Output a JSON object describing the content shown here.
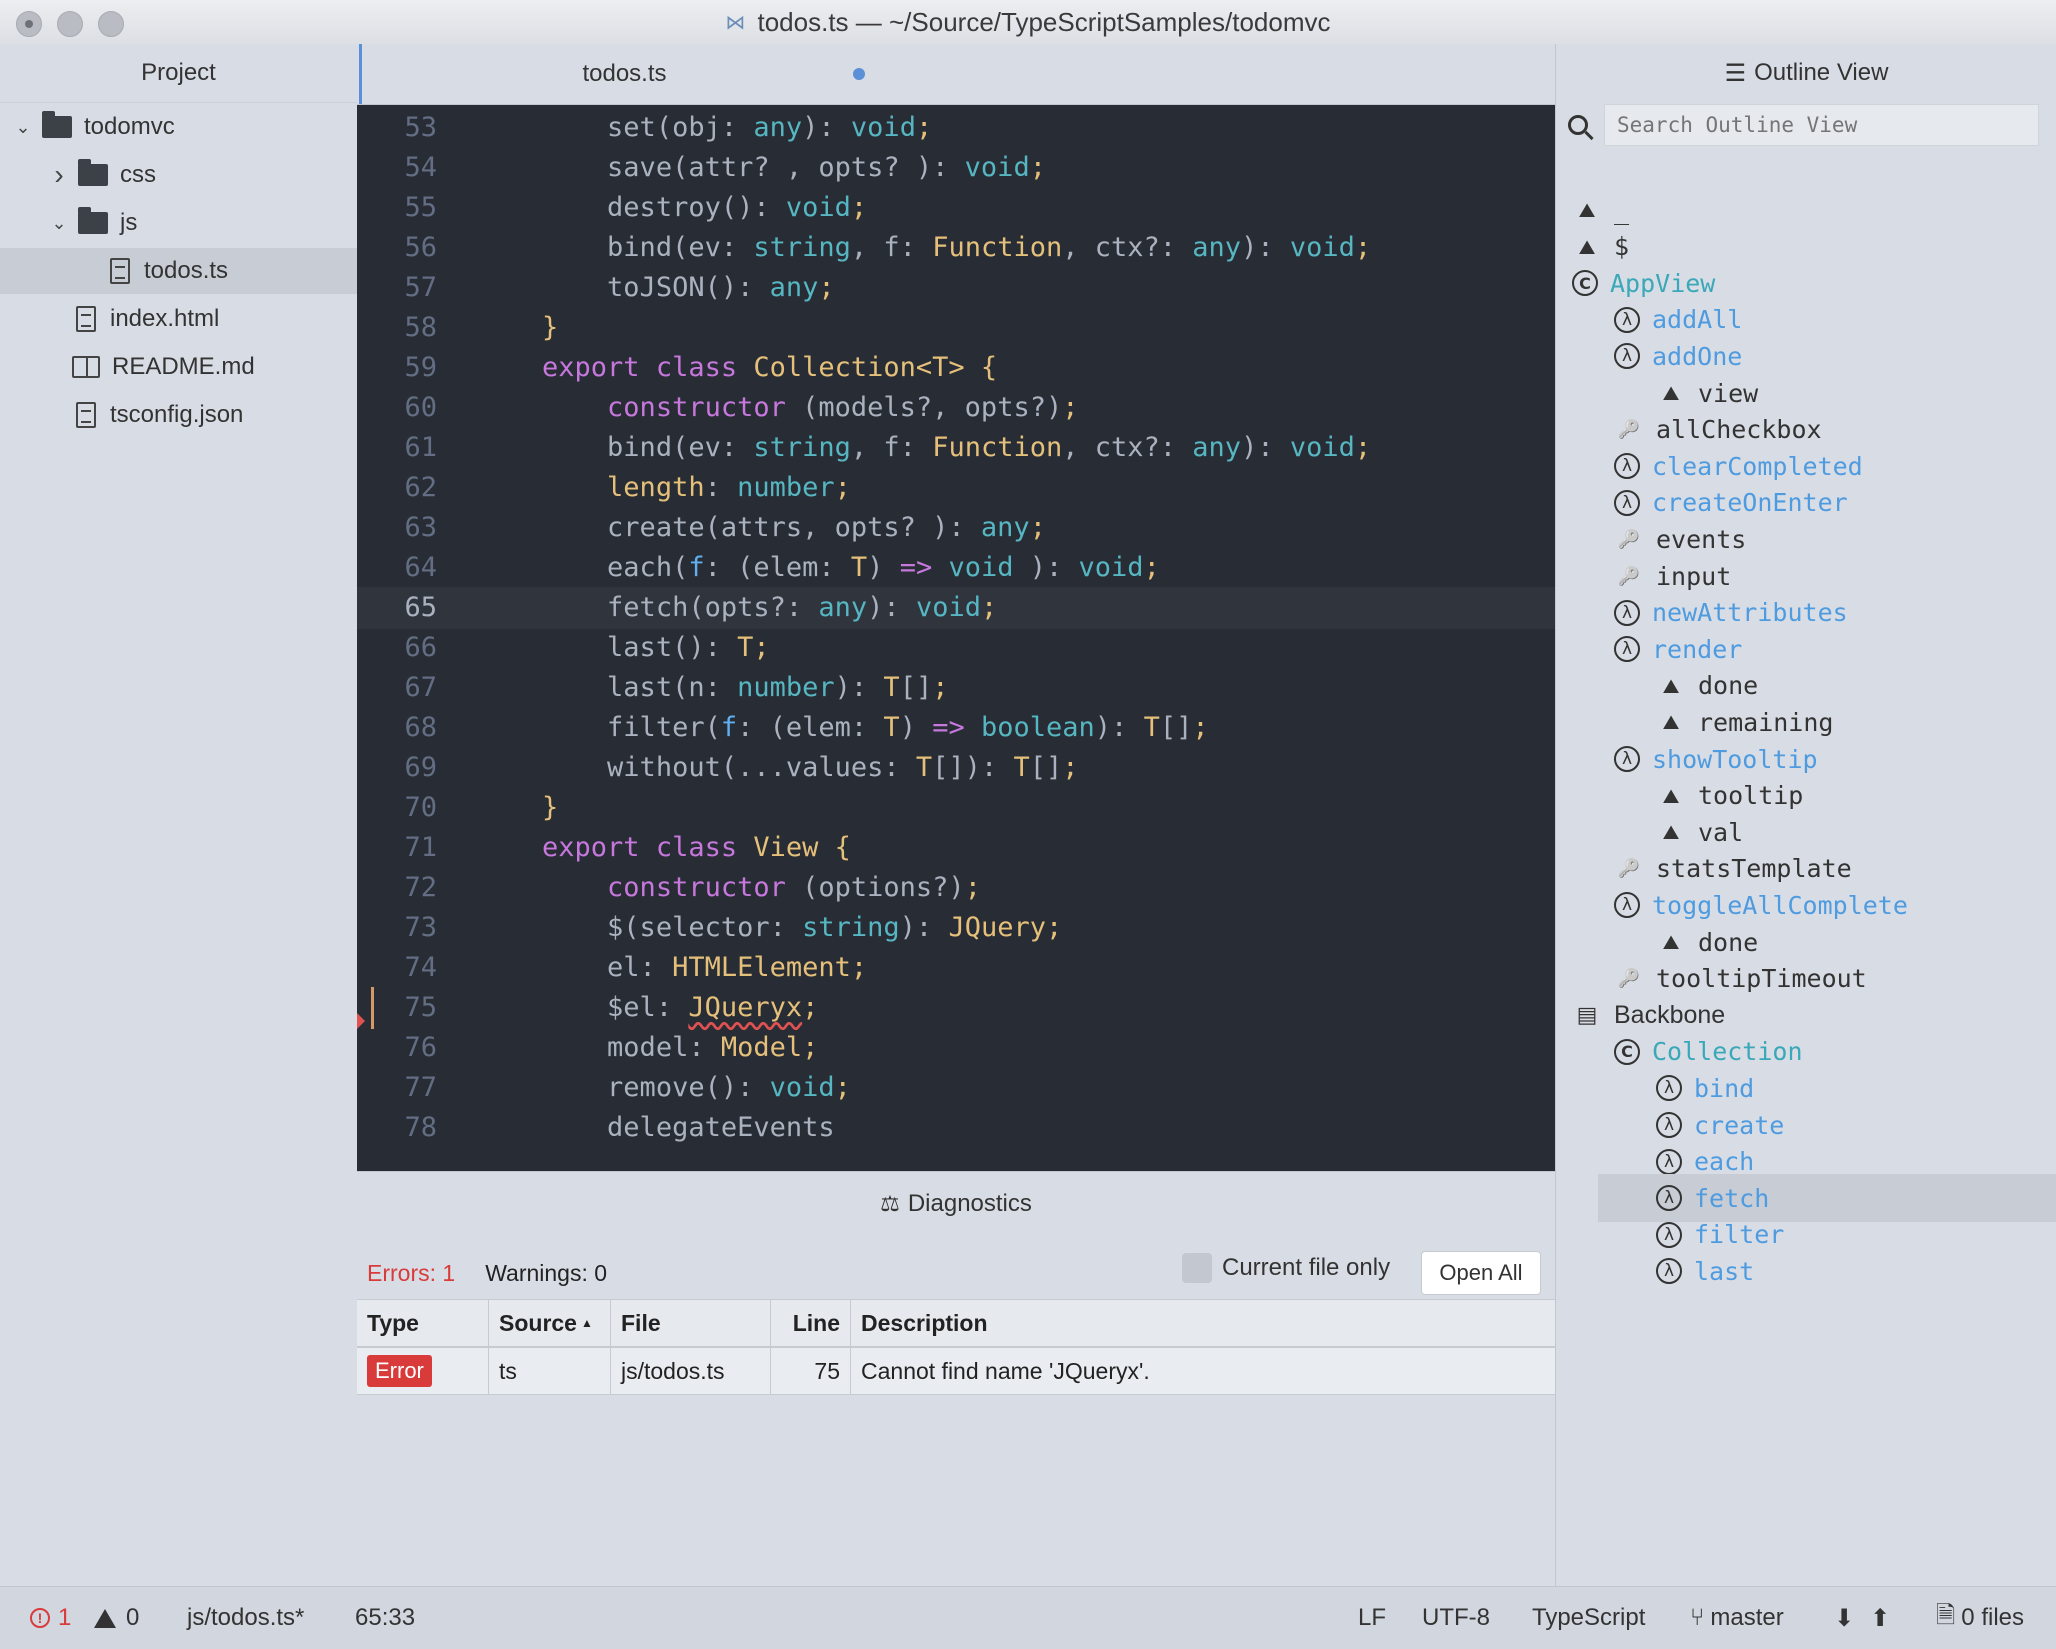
{
  "window": {
    "title": "todos.ts — ~/Source/TypeScriptSamples/todomvc"
  },
  "project": {
    "header": "Project",
    "tree": [
      {
        "label": "todomvc",
        "kind": "folder",
        "expanded": true
      },
      {
        "label": "css",
        "kind": "folder",
        "expanded": false
      },
      {
        "label": "js",
        "kind": "folder",
        "expanded": true
      },
      {
        "label": "todos.ts",
        "kind": "file",
        "selected": true
      },
      {
        "label": "index.html",
        "kind": "file"
      },
      {
        "label": "README.md",
        "kind": "book"
      },
      {
        "label": "tsconfig.json",
        "kind": "file"
      }
    ]
  },
  "editor": {
    "tab": {
      "label": "todos.ts",
      "modified": true
    },
    "current_line": "65",
    "lines": [
      {
        "n": "53",
        "html": "        <span class='pl'>set(obj: </span><span class='ty'>any</span><span class='pl'>): </span><span class='ty'>void</span><span class='br'>;</span>"
      },
      {
        "n": "54",
        "html": "        <span class='pl'>save(attr? , opts? ): </span><span class='ty'>void</span><span class='br'>;</span>"
      },
      {
        "n": "55",
        "html": "        <span class='pl'>destroy(): </span><span class='ty'>void</span><span class='br'>;</span>"
      },
      {
        "n": "56",
        "html": "        <span class='pl'>bind(ev: </span><span class='ty'>string</span><span class='pl'>, f: </span><span class='cl'>Function</span><span class='pl'>, ctx?: </span><span class='ty'>any</span><span class='pl'>): </span><span class='ty'>void</span><span class='br'>;</span>"
      },
      {
        "n": "57",
        "html": "        <span class='pl'>toJSON(): </span><span class='ty'>any</span><span class='br'>;</span>"
      },
      {
        "n": "58",
        "html": "    <span class='br'>}</span>"
      },
      {
        "n": "59",
        "html": "    <span class='kw'>export class </span><span class='cl'>Collection&lt;T&gt; {</span>"
      },
      {
        "n": "60",
        "html": "        <span class='kw'>constructor </span><span class='pl'>(models?, opts?)</span><span class='br'>;</span>"
      },
      {
        "n": "61",
        "html": "        <span class='pl'>bind(ev: </span><span class='ty'>string</span><span class='pl'>, f: </span><span class='cl'>Function</span><span class='pl'>, ctx?: </span><span class='ty'>any</span><span class='pl'>): </span><span class='ty'>void</span><span class='br'>;</span>"
      },
      {
        "n": "62",
        "html": "        <span class='cl'>length</span><span class='pl'>: </span><span class='ty'>number</span><span class='br'>;</span>"
      },
      {
        "n": "63",
        "html": "        <span class='pl'>create(attrs, opts? ): </span><span class='ty'>any</span><span class='br'>;</span>"
      },
      {
        "n": "64",
        "html": "        <span class='pl'>each(</span><span class='bl'>f</span><span class='pl'>: (elem: </span><span class='cl'>T</span><span class='pl'>) </span><span class='kw'>=&gt;</span><span class='pl'> </span><span class='ty'>void</span><span class='pl'> ): </span><span class='ty'>void</span><span class='br'>;</span>"
      },
      {
        "n": "65",
        "html": "        <span class='pl'>fetch(opts?: </span><span class='ty'>any</span><span class='pl'>): </span><span class='ty'>void</span><span class='br'>;</span>"
      },
      {
        "n": "66",
        "html": "        <span class='pl'>last(): </span><span class='cl'>T</span><span class='br'>;</span>"
      },
      {
        "n": "67",
        "html": "        <span class='pl'>last(n: </span><span class='ty'>number</span><span class='pl'>): </span><span class='cl'>T</span><span class='pl'>[]</span><span class='br'>;</span>"
      },
      {
        "n": "68",
        "html": "        <span class='pl'>filter(</span><span class='bl'>f</span><span class='pl'>: (elem: </span><span class='cl'>T</span><span class='pl'>) </span><span class='kw'>=&gt;</span><span class='pl'> </span><span class='ty'>boolean</span><span class='pl'>): </span><span class='cl'>T</span><span class='pl'>[]</span><span class='br'>;</span>"
      },
      {
        "n": "69",
        "html": "        <span class='pl'>without(...values: </span><span class='cl'>T</span><span class='pl'>[]): </span><span class='cl'>T</span><span class='pl'>[]</span><span class='br'>;</span>"
      },
      {
        "n": "70",
        "html": "    <span class='br'>}</span>"
      },
      {
        "n": "71",
        "html": "    <span class='kw'>export class </span><span class='cl'>View {</span>"
      },
      {
        "n": "72",
        "html": "        <span class='kw'>constructor </span><span class='pl'>(options?)</span><span class='br'>;</span>"
      },
      {
        "n": "73",
        "html": "        <span class='pl'>$(selector: </span><span class='ty'>string</span><span class='pl'>): </span><span class='cl'>JQuery</span><span class='br'>;</span>"
      },
      {
        "n": "74",
        "html": "        <span class='pl'>el: </span><span class='cl'>HTMLElement</span><span class='br'>;</span>"
      },
      {
        "n": "75",
        "html": "        <span class='pl'>$el: </span><span class='cl err-ul'>JQueryx</span><span class='br'>;</span>"
      },
      {
        "n": "76",
        "html": "        <span class='pl'>model: </span><span class='cl'>Model</span><span class='br'>;</span>"
      },
      {
        "n": "77",
        "html": "        <span class='pl'>remove(): </span><span class='ty'>void</span><span class='br'>;</span>"
      },
      {
        "n": "78",
        "html": "        <span class='pl'>delegateEvents</span>"
      }
    ],
    "error_line": "75"
  },
  "diagnostics": {
    "header": "Diagnostics",
    "errors_label": "Errors: 1",
    "warnings_label": "Warnings: 0",
    "current_file_label": "Current file only",
    "open_all_label": "Open All",
    "columns": [
      "Type",
      "Source",
      "File",
      "Line",
      "Description"
    ],
    "rows": [
      {
        "type": "Error",
        "source": "ts",
        "file": "js/todos.ts",
        "line": "75",
        "description": "Cannot find name 'JQueryx'."
      }
    ]
  },
  "outline": {
    "header": "Outline View",
    "search_placeholder": "Search Outline View",
    "items": [
      {
        "label": "_",
        "icon": "variable",
        "depth": 0
      },
      {
        "label": "$",
        "icon": "variable",
        "depth": 0
      },
      {
        "label": "AppView",
        "icon": "class",
        "depth": 0
      },
      {
        "label": "addAll",
        "icon": "function",
        "depth": 1
      },
      {
        "label": "addOne",
        "icon": "function",
        "depth": 1
      },
      {
        "label": "view",
        "icon": "variable",
        "depth": 2
      },
      {
        "label": "allCheckbox",
        "icon": "property",
        "depth": 1
      },
      {
        "label": "clearCompleted",
        "icon": "function",
        "depth": 1
      },
      {
        "label": "createOnEnter",
        "icon": "function",
        "depth": 1
      },
      {
        "label": "events",
        "icon": "property",
        "depth": 1
      },
      {
        "label": "input",
        "icon": "property",
        "depth": 1
      },
      {
        "label": "newAttributes",
        "icon": "function",
        "depth": 1
      },
      {
        "label": "render",
        "icon": "function",
        "depth": 1
      },
      {
        "label": "done",
        "icon": "variable",
        "depth": 2
      },
      {
        "label": "remaining",
        "icon": "variable",
        "depth": 2
      },
      {
        "label": "showTooltip",
        "icon": "function",
        "depth": 1
      },
      {
        "label": "tooltip",
        "icon": "variable",
        "depth": 2
      },
      {
        "label": "val",
        "icon": "variable",
        "depth": 2
      },
      {
        "label": "statsTemplate",
        "icon": "property",
        "depth": 1
      },
      {
        "label": "toggleAllComplete",
        "icon": "function",
        "depth": 1
      },
      {
        "label": "done",
        "icon": "variable",
        "depth": 2
      },
      {
        "label": "tooltipTimeout",
        "icon": "property",
        "depth": 1
      },
      {
        "label": "Backbone",
        "icon": "module",
        "depth": 0
      },
      {
        "label": "Collection",
        "icon": "class",
        "depth": 1
      },
      {
        "label": "bind",
        "icon": "function",
        "depth": 2
      },
      {
        "label": "create",
        "icon": "function",
        "depth": 2
      },
      {
        "label": "each",
        "icon": "function",
        "depth": 2
      },
      {
        "label": "fetch",
        "icon": "function",
        "depth": 2,
        "selected": true
      },
      {
        "label": "filter",
        "icon": "function",
        "depth": 2
      },
      {
        "label": "last",
        "icon": "function",
        "depth": 2
      }
    ]
  },
  "statusbar": {
    "errors": "1",
    "warnings": "0",
    "file": "js/todos.ts*",
    "cursor": "65:33",
    "line_ending": "LF",
    "encoding": "UTF-8",
    "grammar": "TypeScript",
    "branch": "master",
    "files": "0 files"
  },
  "colors": {
    "editor_bg": "#282c34",
    "accent": "#5b8fd6",
    "error": "#d93b3b"
  }
}
